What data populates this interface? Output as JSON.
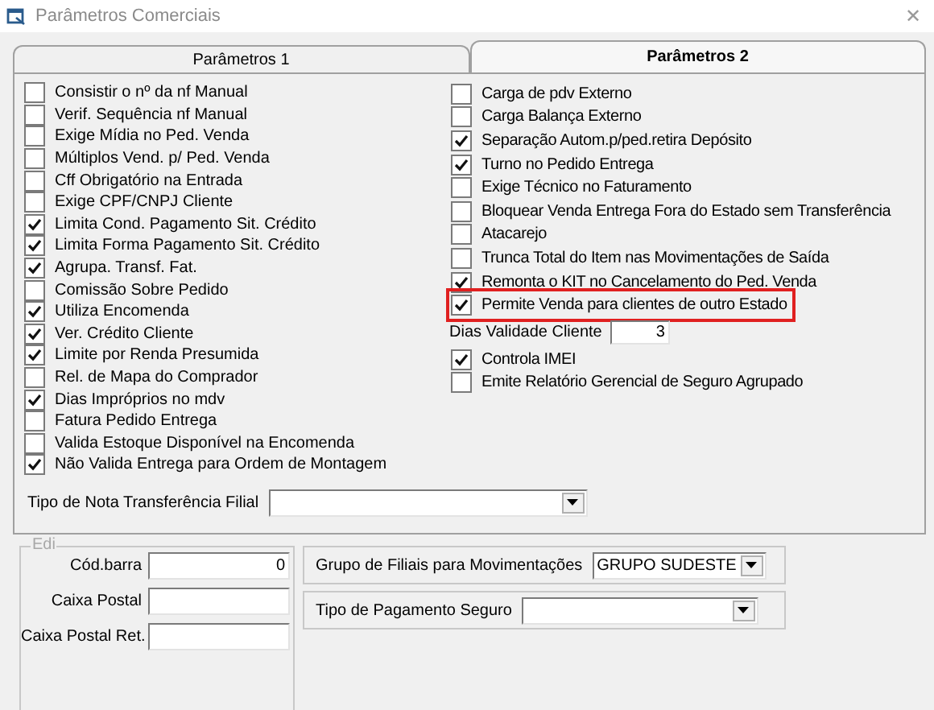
{
  "window": {
    "title": "Parâmetros Comerciais",
    "close": "✕"
  },
  "tabs": [
    {
      "label": "Parâmetros 1",
      "selected": false
    },
    {
      "label": "Parâmetros 2",
      "selected": true
    }
  ],
  "left_options": [
    {
      "label": "Consistir o nº da nf Manual",
      "checked": false
    },
    {
      "label": "Verif. Sequência nf Manual",
      "checked": false
    },
    {
      "label": "Exige Mídia no Ped. Venda",
      "checked": false
    },
    {
      "label": "Múltiplos Vend. p/ Ped. Venda",
      "checked": false
    },
    {
      "label": "Cff Obrigatório na Entrada",
      "checked": false
    },
    {
      "label": "Exige CPF/CNPJ Cliente",
      "checked": false
    },
    {
      "label": "Limita Cond. Pagamento Sit. Crédito",
      "checked": true
    },
    {
      "label": "Limita Forma Pagamento Sit. Crédito",
      "checked": true
    },
    {
      "label": "Agrupa. Transf. Fat.",
      "checked": true
    },
    {
      "label": "Comissão Sobre Pedido",
      "checked": false
    },
    {
      "label": "Utiliza Encomenda",
      "checked": true
    },
    {
      "label": "Ver. Crédito Cliente",
      "checked": true
    },
    {
      "label": "Limite por Renda Presumida",
      "checked": true
    },
    {
      "label": "Rel. de Mapa do Comprador",
      "checked": false
    },
    {
      "label": "Dias Impróprios no mdv",
      "checked": true
    },
    {
      "label": "Fatura Pedido Entrega",
      "checked": false
    },
    {
      "label": "Valida Estoque Disponível na Encomenda",
      "checked": false
    },
    {
      "label": "Não Valida Entrega para Ordem de Montagem",
      "checked": true
    }
  ],
  "right_options": [
    {
      "kind": "checkbox",
      "label": "Carga de pdv Externo",
      "checked": false,
      "highlighted": false
    },
    {
      "kind": "checkbox",
      "label": "Carga Balança Externo",
      "checked": false,
      "highlighted": false
    },
    {
      "kind": "checkbox",
      "label": "Separação Autom.p/ped.retira Depósito",
      "checked": true,
      "highlighted": false
    },
    {
      "kind": "checkbox",
      "label": "Turno no Pedido Entrega",
      "checked": true,
      "highlighted": false
    },
    {
      "kind": "checkbox",
      "label": "Exige Técnico no Faturamento",
      "checked": false,
      "highlighted": false
    },
    {
      "kind": "checkbox",
      "label": "Bloquear Venda Entrega Fora do Estado sem Transferência",
      "checked": false,
      "highlighted": false
    },
    {
      "kind": "checkbox",
      "label": "Atacarejo",
      "checked": false,
      "highlighted": false
    },
    {
      "kind": "checkbox",
      "label": "Trunca Total do Item nas Movimentações de Saída",
      "checked": false,
      "highlighted": false
    },
    {
      "kind": "checkbox",
      "label": "Remonta o KIT no Cancelamento do Ped. Venda",
      "checked": true,
      "highlighted": false
    },
    {
      "kind": "checkbox",
      "label": "Permite Venda para clientes de outro Estado",
      "checked": true,
      "highlighted": true
    },
    {
      "kind": "field",
      "label": "Dias Validade Cliente",
      "value": "3"
    },
    {
      "kind": "checkbox",
      "label": "Controla IMEI",
      "checked": true,
      "highlighted": false
    },
    {
      "kind": "checkbox",
      "label": "Emite Relatório Gerencial de Seguro Agrupado",
      "checked": false,
      "highlighted": false
    }
  ],
  "transfer_note_type": {
    "label": "Tipo de Nota Transferência Filial"
  },
  "edi": {
    "title": "Edi",
    "fields": [
      {
        "label": "Cód.barra",
        "value": "0"
      },
      {
        "label": "Caixa Postal"
      },
      {
        "label": "Caixa Postal Ret."
      }
    ]
  },
  "branch_group": {
    "label": "Grupo de Filiais para Movimentações",
    "value": "GRUPO SUDESTE"
  },
  "insurance_payment": {
    "label": "Tipo de Pagamento Seguro"
  }
}
